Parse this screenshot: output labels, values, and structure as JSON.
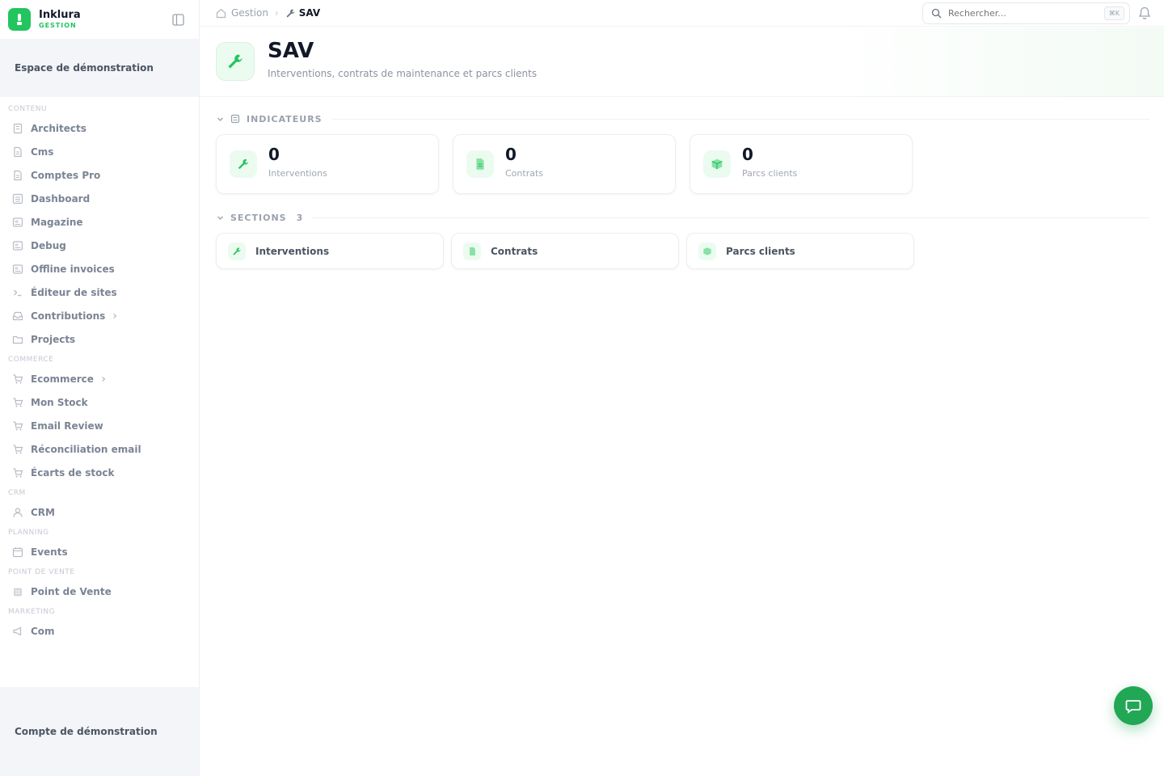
{
  "brand": {
    "name": "Inklura",
    "subtitle": "GESTION"
  },
  "colors": {
    "accent": "#22c55e",
    "accent_dark": "#22a755",
    "muted_text": "#7b8494"
  },
  "sidebar": {
    "workspace_label": "Espace de démonstration",
    "account_label": "Compte de démonstration",
    "sections": [
      {
        "title": "CONTENU",
        "items": [
          {
            "label": "Architects",
            "icon": "building-icon"
          },
          {
            "label": "Cms",
            "icon": "document-icon"
          },
          {
            "label": "Comptes Pro",
            "icon": "document-icon"
          },
          {
            "label": "Dashboard",
            "icon": "dashboard-icon"
          },
          {
            "label": "Magazine",
            "icon": "newspaper-icon"
          },
          {
            "label": "Debug",
            "icon": "newspaper-icon"
          },
          {
            "label": "Offline invoices",
            "icon": "newspaper-icon"
          },
          {
            "label": "Éditeur de sites",
            "icon": "terminal-icon"
          },
          {
            "label": "Contributions",
            "icon": "inbox-icon",
            "has_children": true
          },
          {
            "label": "Projects",
            "icon": "folder-icon"
          }
        ]
      },
      {
        "title": "COMMERCE",
        "items": [
          {
            "label": "Ecommerce",
            "icon": "cart-icon",
            "has_children": true
          },
          {
            "label": "Mon Stock",
            "icon": "cart-icon"
          },
          {
            "label": "Email Review",
            "icon": "cart-icon"
          },
          {
            "label": "Réconciliation email",
            "icon": "cart-icon"
          },
          {
            "label": "Écarts de stock",
            "icon": "cart-icon"
          }
        ]
      },
      {
        "title": "CRM",
        "items": [
          {
            "label": "CRM",
            "icon": "user-icon"
          }
        ]
      },
      {
        "title": "PLANNING",
        "items": [
          {
            "label": "Events",
            "icon": "calendar-icon"
          }
        ]
      },
      {
        "title": "POINT DE VENTE",
        "items": [
          {
            "label": "Point de Vente",
            "icon": "store-icon"
          }
        ]
      },
      {
        "title": "MARKETING",
        "items": [
          {
            "label": "Com",
            "icon": "megaphone-icon"
          }
        ]
      }
    ]
  },
  "topbar": {
    "breadcrumb_root": "Gestion",
    "breadcrumb_current": "SAV",
    "search_placeholder": "Rechercher...",
    "search_shortcut": "⌘K"
  },
  "page": {
    "title": "SAV",
    "subtitle": "Interventions, contrats de maintenance et parcs clients"
  },
  "indicators": {
    "title": "INDICATEURS",
    "cards": [
      {
        "value": "0",
        "label": "Interventions",
        "icon": "wrench-icon"
      },
      {
        "value": "0",
        "label": "Contrats",
        "icon": "file-icon"
      },
      {
        "value": "0",
        "label": "Parcs clients",
        "icon": "box-icon"
      }
    ]
  },
  "sections": {
    "title": "SECTIONS",
    "count": "3",
    "cards": [
      {
        "label": "Interventions",
        "icon": "wrench-icon"
      },
      {
        "label": "Contrats",
        "icon": "file-icon"
      },
      {
        "label": "Parcs clients",
        "icon": "box-icon"
      }
    ]
  },
  "chat": {
    "icon": "chat-icon"
  }
}
